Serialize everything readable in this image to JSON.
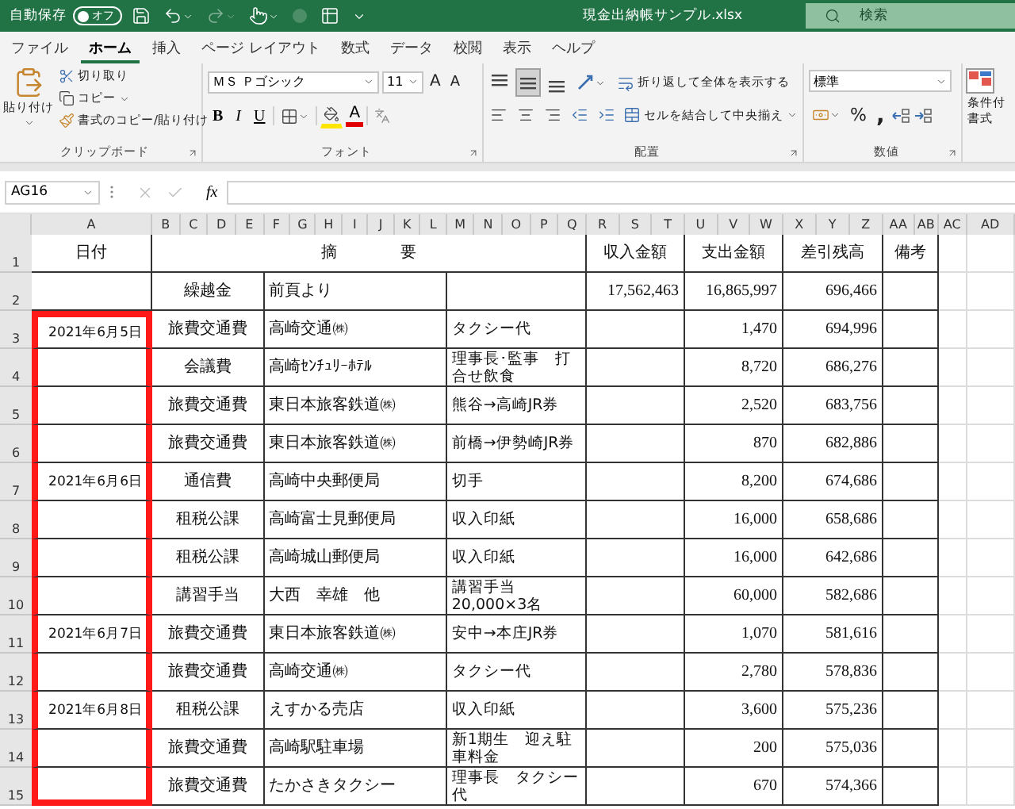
{
  "title_bar": {
    "autosave": "自動保存",
    "autosave_toggle": {
      "label": "オフ",
      "on": false
    },
    "filename": "現金出納帳サンプル.xlsx",
    "search_placeholder": "検索"
  },
  "menu_tabs": [
    {
      "label": "ファイル",
      "selected": false
    },
    {
      "label": "ホーム",
      "selected": true
    },
    {
      "label": "挿入",
      "selected": false
    },
    {
      "label": "ページ レイアウト",
      "selected": false
    },
    {
      "label": "数式",
      "selected": false
    },
    {
      "label": "データ",
      "selected": false
    },
    {
      "label": "校閲",
      "selected": false
    },
    {
      "label": "表示",
      "selected": false
    },
    {
      "label": "ヘルプ",
      "selected": false
    }
  ],
  "ribbon": {
    "clipboard": {
      "paste": "貼り付け",
      "cut": "切り取り",
      "copy": "コピー",
      "format_painter": "書式のコピー/貼り付け",
      "title": "クリップボード"
    },
    "font": {
      "font_name": "ＭＳ Ｐゴシック",
      "font_size": "11",
      "grow": "A",
      "shrink": "A",
      "bold": "B",
      "italic": "I",
      "underline": "U",
      "font_color": "A",
      "title": "フォント"
    },
    "alignment": {
      "vertical": [
        {
          "selected": false
        },
        {
          "selected": true
        },
        {
          "selected": false
        }
      ],
      "wrap_text": "折り返して全体を表示する",
      "merge": "セルを結合して中央揃え",
      "title": "配置"
    },
    "number": {
      "format": "標準",
      "percent": "%",
      "comma": ",",
      "title": "数値"
    },
    "styles": {
      "conditional": "条件付",
      "format": "書式"
    }
  },
  "formula_bar": {
    "name_box": "AG16",
    "function_label": "fx"
  },
  "columns": [
    "A",
    "B",
    "C",
    "D",
    "E",
    "F",
    "G",
    "H",
    "I",
    "J",
    "K",
    "L",
    "M",
    "N",
    "O",
    "P",
    "Q",
    "R",
    "S",
    "T",
    "U",
    "V",
    "W",
    "X",
    "Y",
    "Z",
    "AA",
    "AB",
    "AC",
    "AD"
  ],
  "header_row": {
    "row": "1",
    "date": "日付",
    "description": "摘　　　　要",
    "income": "収入金額",
    "expense": "支出金額",
    "balance": "差引残高",
    "remarks": "備考"
  },
  "rows": [
    {
      "row": "2",
      "framed": false,
      "category": "繰越金",
      "payee": "前頁より",
      "income": "17,562,463",
      "expense": "16,865,997",
      "balance": "696,466"
    },
    {
      "row": "3",
      "framed": true,
      "date": "2021年6月5日",
      "category": "旅費交通費",
      "payee": "高崎交通㈱",
      "memo": "タクシー代",
      "expense": "1,470",
      "balance": "694,996"
    },
    {
      "row": "4",
      "framed": true,
      "category": "会議費",
      "payee": "高崎ｾﾝﾁｭﾘｰﾎﾃﾙ",
      "memo": "理事長･監事　打合せ飲食",
      "expense": "8,720",
      "balance": "686,276"
    },
    {
      "row": "5",
      "framed": true,
      "category": "旅費交通費",
      "payee": "東日本旅客鉄道㈱",
      "memo": "熊谷→高崎JR券",
      "expense": "2,520",
      "balance": "683,756"
    },
    {
      "row": "6",
      "framed": true,
      "category": "旅費交通費",
      "payee": "東日本旅客鉄道㈱",
      "memo": "前橋→伊勢崎JR券",
      "expense": "870",
      "balance": "682,886"
    },
    {
      "row": "7",
      "framed": true,
      "date": "2021年6月6日",
      "category": "通信費",
      "payee": "高崎中央郵便局",
      "memo": "切手",
      "expense": "8,200",
      "balance": "674,686"
    },
    {
      "row": "8",
      "framed": true,
      "category": "租税公課",
      "payee": "高崎富士見郵便局",
      "memo": "収入印紙",
      "expense": "16,000",
      "balance": "658,686"
    },
    {
      "row": "9",
      "framed": true,
      "category": "租税公課",
      "payee": "高崎城山郵便局",
      "memo": "収入印紙",
      "expense": "16,000",
      "balance": "642,686"
    },
    {
      "row": "10",
      "framed": true,
      "category": "講習手当",
      "payee": "大西　幸雄　他",
      "memo": "講習手当20,000×3名",
      "expense": "60,000",
      "balance": "582,686"
    },
    {
      "row": "11",
      "framed": true,
      "date": "2021年6月7日",
      "category": "旅費交通費",
      "payee": "東日本旅客鉄道㈱",
      "memo": "安中→本庄JR券",
      "expense": "1,070",
      "balance": "581,616"
    },
    {
      "row": "12",
      "framed": true,
      "category": "旅費交通費",
      "payee": "高崎交通㈱",
      "memo": "タクシー代",
      "expense": "2,780",
      "balance": "578,836"
    },
    {
      "row": "13",
      "framed": true,
      "date": "2021年6月8日",
      "category": "租税公課",
      "payee": "えすかる売店",
      "memo": "収入印紙",
      "expense": "3,600",
      "balance": "575,236"
    },
    {
      "row": "14",
      "framed": true,
      "category": "旅費交通費",
      "payee": "高崎駅駐車場",
      "memo": "新1期生　迎え駐車料金",
      "expense": "200",
      "balance": "575,036"
    },
    {
      "row": "15",
      "framed": true,
      "category": "旅費交通費",
      "payee": "たかさきタクシー",
      "memo": "理事長　タクシー代",
      "expense": "670",
      "balance": "574,366"
    }
  ]
}
